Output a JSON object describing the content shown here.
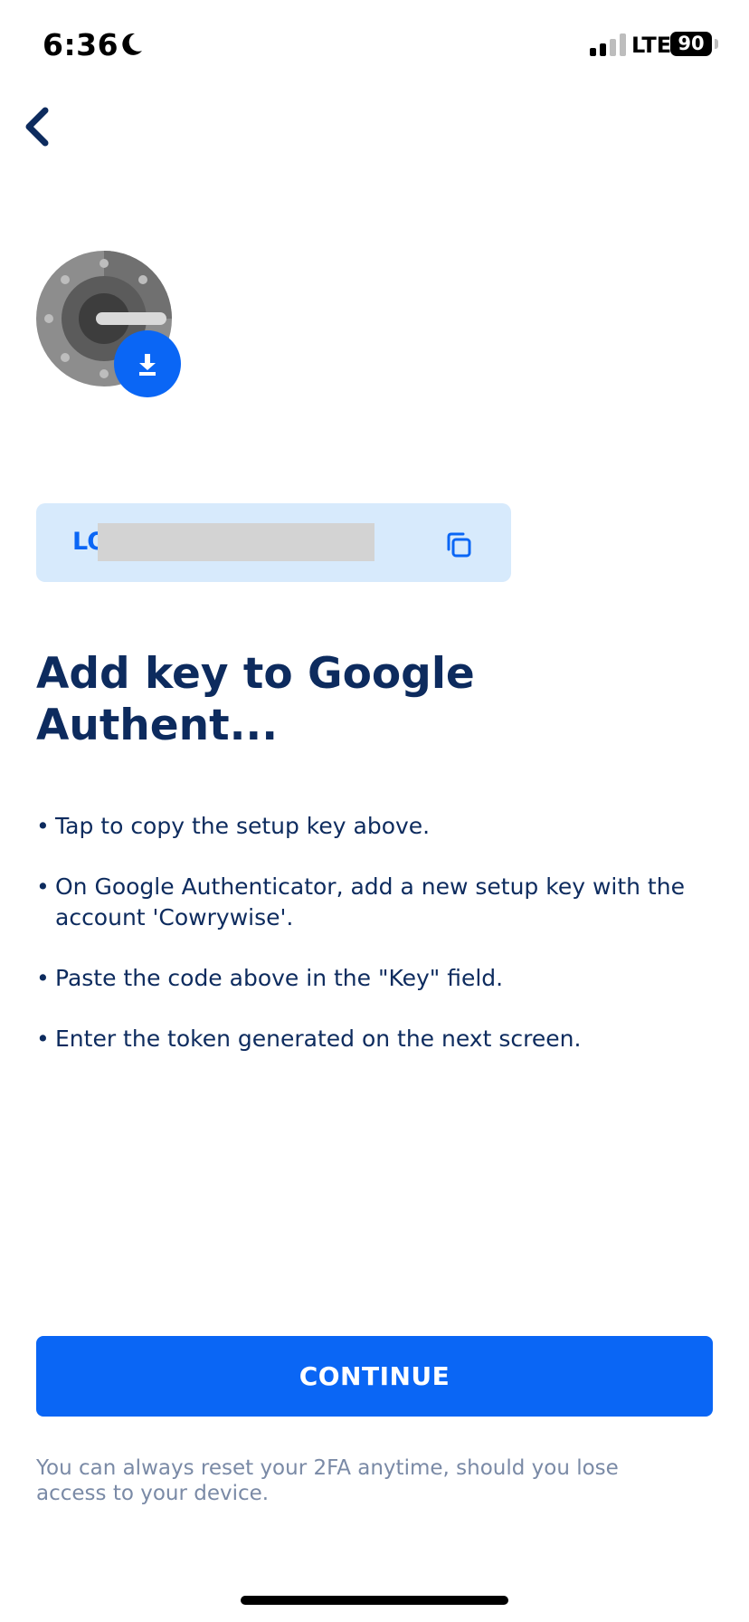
{
  "status_bar": {
    "time": "6:36",
    "network": "LTE",
    "battery_level": "90",
    "signal_bars_active": 2,
    "signal_bars_total": 4
  },
  "nav": {
    "back_icon": "chevron-left-icon"
  },
  "app_icon": {
    "name": "google-authenticator-icon",
    "badge_icon": "download-icon"
  },
  "setup_key": {
    "visible_prefix": "LO",
    "redacted": true,
    "copy_icon": "copy-icon"
  },
  "title": "Add key to Google Authent...",
  "instructions": [
    "Tap to copy the setup key above.",
    "On Google Authenticator, add a new setup key with the account 'Cowrywise'.",
    "Paste the code above in the \"Key\" field.",
    "Enter the token generated on the next screen."
  ],
  "continue_label": "CONTINUE",
  "footnote": "You can always reset your 2FA anytime, should you lose access to your device.",
  "colors": {
    "primary": "#0a66f5",
    "navy_text": "#0d2b5e",
    "key_box_bg": "#d7eafc",
    "muted_text": "#7a8aa6"
  }
}
